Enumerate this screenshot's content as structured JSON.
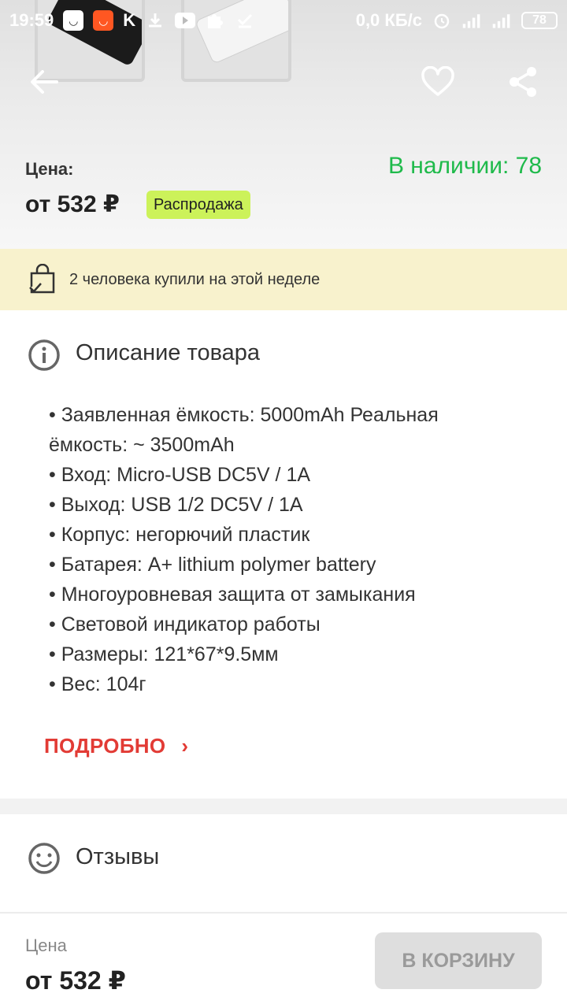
{
  "status_bar": {
    "time": "19:59",
    "network_speed": "0,0 КБ/с",
    "battery": "78",
    "k_label": "K"
  },
  "product": {
    "price_label": "Цена:",
    "price": "от 532 ₽",
    "stock": "В наличии: 78",
    "sale_badge": "Распродажа"
  },
  "bought": {
    "text": "2 человека купили на этой неделе"
  },
  "description": {
    "title": "Описание товара",
    "items": [
      "• Заявленная ёмкость: 5000mAh Реальная ёмкость: ~ 3500mAh",
      "• Вход: Micro-USB DC5V / 1A",
      "• Выход: USB 1/2 DC5V / 1A",
      "• Корпус: негорючий пластик",
      "• Батарея: A+ lithium polymer battery",
      "• Многоуровневая защита от замыкания",
      "• Световой индикатор работы",
      "• Размеры: 121*67*9.5мм",
      "• Вес: 104г"
    ],
    "more_label": "ПОДРОБНО",
    "more_chevron": "›"
  },
  "reviews": {
    "title": "Отзывы"
  },
  "bottom_bar": {
    "price_label": "Цена",
    "price": "от 532 ₽",
    "cart_button": "В КОРЗИНУ"
  },
  "colors": {
    "stock_green": "#1fba4b",
    "sale_badge_bg": "#ccf25a",
    "bought_strip_bg": "#f8f2cd",
    "more_link_red": "#e23b35"
  }
}
